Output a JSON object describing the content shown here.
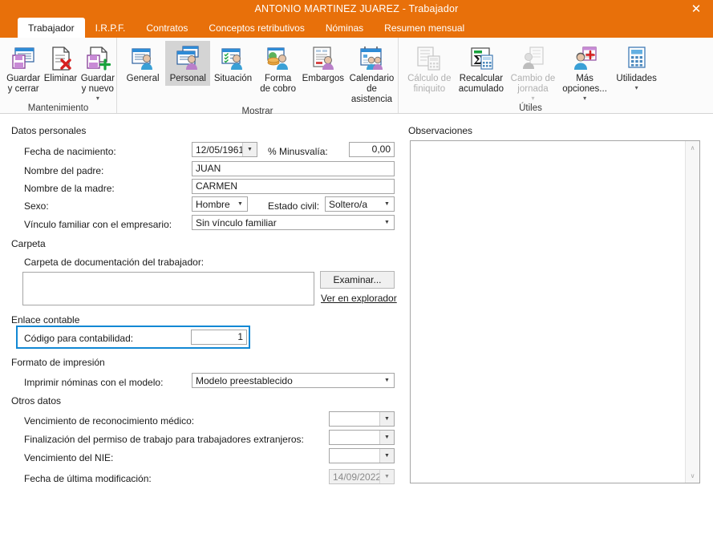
{
  "window": {
    "title": "ANTONIO MARTINEZ JUAREZ - Trabajador",
    "close_label": "✕",
    "accent_color": "#E8700A"
  },
  "tabs": [
    {
      "label": "Trabajador",
      "active": true
    },
    {
      "label": "I.R.P.F.",
      "active": false
    },
    {
      "label": "Contratos",
      "active": false
    },
    {
      "label": "Conceptos retributivos",
      "active": false
    },
    {
      "label": "Nóminas",
      "active": false
    },
    {
      "label": "Resumen mensual",
      "active": false
    }
  ],
  "ribbon": {
    "groups": [
      {
        "label": "Mantenimiento",
        "buttons": [
          {
            "label": "Guardar\ny cerrar",
            "icon": "save-close-icon",
            "state": "normal",
            "caret": false
          },
          {
            "label": "Eliminar",
            "icon": "delete-document-icon",
            "state": "normal",
            "caret": false
          },
          {
            "label": "Guardar\ny nuevo",
            "icon": "save-new-icon",
            "state": "normal",
            "caret": true
          }
        ]
      },
      {
        "label": "Mostrar",
        "buttons": [
          {
            "label": "General",
            "icon": "person-general-icon",
            "state": "normal",
            "caret": false
          },
          {
            "label": "Personal",
            "icon": "person-personal-icon",
            "state": "selected",
            "caret": false
          },
          {
            "label": "Situación",
            "icon": "person-checklist-icon",
            "state": "normal",
            "caret": false
          },
          {
            "label": "Forma\nde cobro",
            "icon": "money-payment-icon",
            "state": "normal",
            "caret": false
          },
          {
            "label": "Embargos",
            "icon": "document-person-icon",
            "state": "normal",
            "caret": false
          },
          {
            "label": "Calendario\nde asistencia",
            "icon": "calendar-people-icon",
            "state": "normal",
            "caret": false
          }
        ]
      },
      {
        "label": "Útiles",
        "buttons": [
          {
            "label": "Cálculo de\nfiniquito",
            "icon": "calc-documents-icon",
            "state": "disabled",
            "caret": false
          },
          {
            "label": "Recalcular\nacumulado",
            "icon": "sigma-calculator-icon",
            "state": "normal",
            "caret": false
          },
          {
            "label": "Cambio de\njornada",
            "icon": "person-document-icon",
            "state": "disabled",
            "caret": true
          },
          {
            "label": "Más\nopciones...",
            "icon": "person-plus-icon",
            "state": "normal",
            "caret": true
          },
          {
            "label": "Utilidades",
            "icon": "calculator-icon",
            "state": "normal",
            "caret": true
          }
        ]
      }
    ]
  },
  "form": {
    "sections": {
      "datos_personales": "Datos personales",
      "carpeta": "Carpeta",
      "enlace_contable": "Enlace contable",
      "formato_impresion": "Formato de impresión",
      "otros_datos": "Otros datos"
    },
    "fecha_nacimiento": {
      "label": "Fecha de nacimiento:",
      "value": "12/05/1961"
    },
    "minusvalia": {
      "label": "% Minusvalía:",
      "value": "0,00"
    },
    "nombre_padre": {
      "label": "Nombre del padre:",
      "value": "JUAN"
    },
    "nombre_madre": {
      "label": "Nombre de la madre:",
      "value": "CARMEN"
    },
    "sexo": {
      "label": "Sexo:",
      "value": "Hombre"
    },
    "estado_civil": {
      "label": "Estado civil:",
      "value": "Soltero/a"
    },
    "vinculo_familiar": {
      "label": "Vínculo familiar con el empresario:",
      "value": "Sin vínculo familiar"
    },
    "carpeta_doc": {
      "label": "Carpeta de documentación del trabajador:",
      "value": ""
    },
    "examinar_button": "Examinar...",
    "ver_explorador_link": "Ver en explorador",
    "codigo_contabilidad": {
      "label": "Código para contabilidad:",
      "value": "1",
      "highlight_color": "#1288d4"
    },
    "imprimir_nominas": {
      "label": "Imprimir nóminas con el modelo:",
      "value": "Modelo preestablecido"
    },
    "vencimiento_medico": {
      "label": "Vencimiento de reconocimiento médico:",
      "value": ""
    },
    "finalizacion_permiso": {
      "label": "Finalización del permiso de trabajo para trabajadores extranjeros:",
      "value": ""
    },
    "vencimiento_nie": {
      "label": "Vencimiento del NIE:",
      "value": ""
    },
    "ultima_modificacion": {
      "label": "Fecha de última modificación:",
      "value": "14/09/2022"
    }
  },
  "observaciones": {
    "title": "Observaciones",
    "value": "",
    "scroll_up": "∧",
    "scroll_down": "∨"
  }
}
